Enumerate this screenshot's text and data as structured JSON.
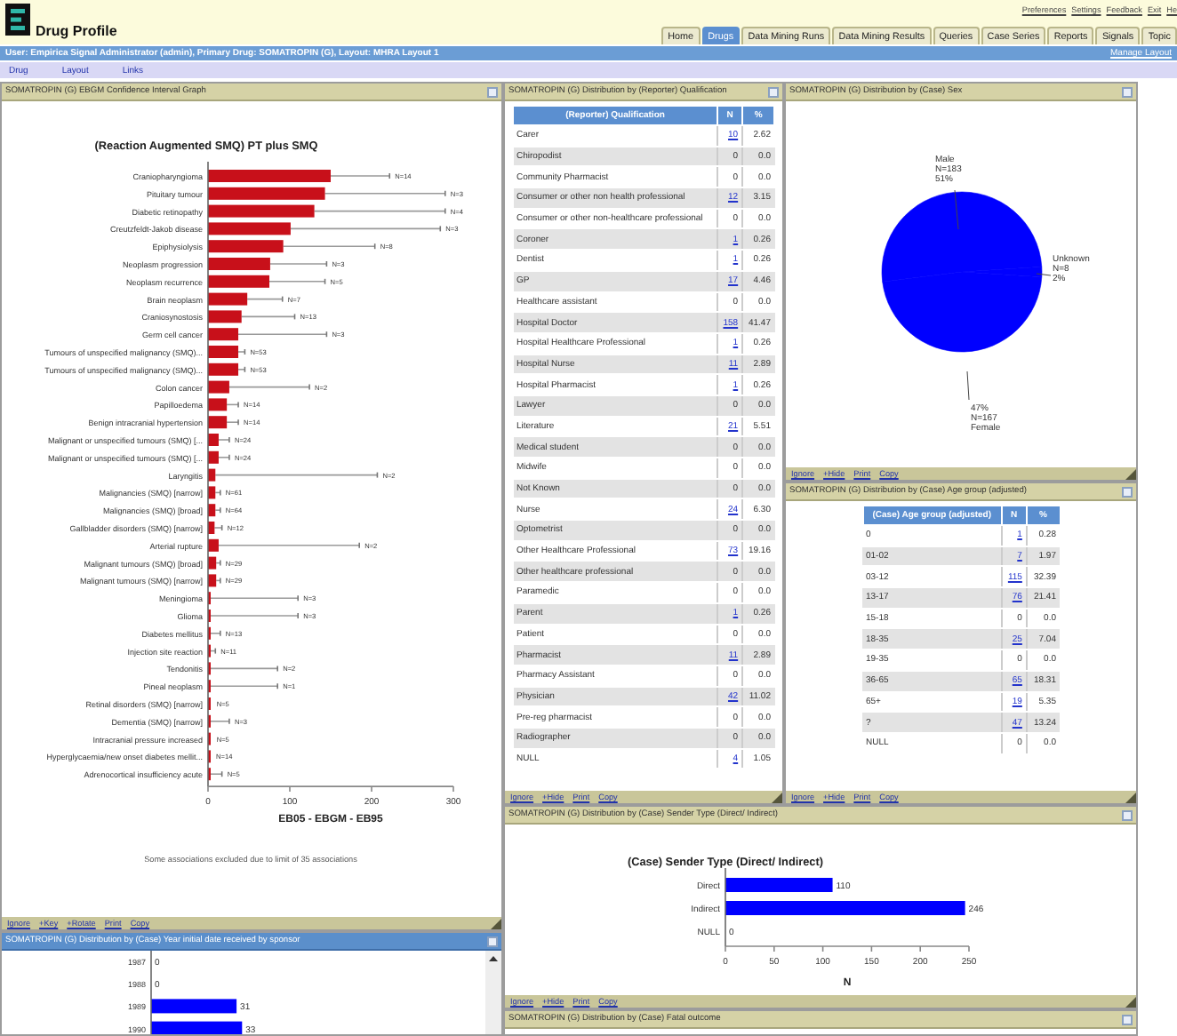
{
  "app": {
    "title": "Drug Profile",
    "links": [
      "Preferences",
      "Settings",
      "Feedback",
      "Exit",
      "He"
    ]
  },
  "tabs": [
    {
      "label": "Home",
      "selected": false
    },
    {
      "label": "Drugs",
      "selected": true
    },
    {
      "label": "Data Mining Runs",
      "selected": false
    },
    {
      "label": "Data Mining Results",
      "selected": false
    },
    {
      "label": "Queries",
      "selected": false
    },
    {
      "label": "Case Series",
      "selected": false
    },
    {
      "label": "Reports",
      "selected": false
    },
    {
      "label": "Signals",
      "selected": false
    },
    {
      "label": "Topic",
      "selected": false
    }
  ],
  "context_bar": {
    "text": "User: Empirica Signal Administrator (admin), Primary Drug: SOMATROPIN (G), Layout: MHRA Layout 1",
    "link": "Manage Layout"
  },
  "menu": [
    "Drug",
    "Layout",
    "Links"
  ],
  "ci_panel": {
    "title": "SOMATROPIN (G) EBGM Confidence Interval Graph",
    "selected": false,
    "chart_data": {
      "type": "bar",
      "orientation": "horizontal",
      "title": "(Reaction Augmented SMQ) PT plus SMQ",
      "xlabel": "EB05 - EBGM - EB95",
      "categories": [
        "Craniopharyngioma",
        "Pituitary tumour",
        "Diabetic retinopathy",
        "Creutzfeldt-Jakob disease",
        "Epiphysiolysis",
        "Neoplasm progression",
        "Neoplasm recurrence",
        "Brain neoplasm",
        "Craniosynostosis",
        "Germ cell cancer",
        "Tumours of unspecified malignancy (SMQ)...",
        "Tumours of unspecified malignancy (SMQ)...",
        "Colon cancer",
        "Papilloedema",
        "Benign intracranial hypertension",
        "Malignant or unspecified tumours (SMQ) [...",
        "Malignant or unspecified tumours (SMQ) [...",
        "Laryngitis",
        "Malignancies (SMQ) [narrow]",
        "Malignancies (SMQ) [broad]",
        "Gallbladder disorders (SMQ) [narrow]",
        "Arterial rupture",
        "Malignant tumours (SMQ) [broad]",
        "Malignant tumours (SMQ) [narrow]",
        "Meningioma",
        "Glioma",
        "Diabetes mellitus",
        "Injection site reaction",
        "Tendonitis",
        "Pineal neoplasm",
        "Retinal disorders (SMQ) [narrow]",
        "Dementia (SMQ) [narrow]",
        "Intracranial pressure increased",
        "Hyperglycaemia/new onset diabetes mellit...",
        "Adrenocortical insufficiency acute"
      ],
      "series": [
        {
          "color": "#c8101a",
          "values": [
            150,
            143,
            130,
            101,
            92,
            76,
            75,
            48,
            41,
            37,
            37,
            37,
            26,
            23,
            23,
            13,
            13,
            9,
            9,
            9,
            8,
            13,
            10,
            10,
            2,
            2,
            1,
            1,
            1,
            1,
            1,
            1,
            1,
            1,
            1
          ]
        }
      ],
      "xlim": [
        0,
        300
      ],
      "xticks": [
        0,
        100,
        200,
        300
      ],
      "annotations": [
        "N=14",
        "N=3",
        "N=4",
        "N=3",
        "N=8",
        "N=3",
        "N=5",
        "N=7",
        "N=13",
        "N=3",
        "N=53",
        "N=53",
        "N=2",
        "N=14",
        "N=14",
        "N=24",
        "N=24",
        "N=2",
        "N=61",
        "N=64",
        "N=12",
        "N=2",
        "N=29",
        "N=29",
        "N=3",
        "N=3",
        "N=13",
        "N=11",
        "N=2",
        "N=1",
        "N=5",
        "N=3",
        "N=5",
        "N=14",
        "N=5"
      ]
    },
    "note": "Some associations excluded due to limit of 35 associations",
    "footer": [
      "Ignore",
      "+Key",
      "+Rotate",
      "Print",
      "Copy"
    ]
  },
  "year_panel": {
    "title": "SOMATROPIN (G) Distribution by (Case) Year initial date received by sponsor",
    "selected": true,
    "chart_data": {
      "type": "bar",
      "orientation": "horizontal",
      "categories": [
        "1987",
        "1988",
        "1989",
        "1990"
      ],
      "series": [
        {
          "color": "#0000ff",
          "values": [
            0,
            0,
            31,
            33
          ]
        }
      ],
      "data_labels": true
    }
  },
  "qualification_panel": {
    "title": "SOMATROPIN (G) Distribution by (Reporter) Qualification",
    "selected": false,
    "columns": [
      "(Reporter) Qualification",
      "N",
      "%"
    ],
    "rows": [
      {
        "label": "Carer",
        "n": "10",
        "pct": "2.62",
        "linked": true
      },
      {
        "label": "Chiropodist",
        "n": "0",
        "pct": "0.0",
        "linked": false
      },
      {
        "label": "Community Pharmacist",
        "n": "0",
        "pct": "0.0",
        "linked": false
      },
      {
        "label": "Consumer or other non health professional",
        "n": "12",
        "pct": "3.15",
        "linked": true
      },
      {
        "label": "Consumer or other non-healthcare professional",
        "n": "0",
        "pct": "0.0",
        "linked": false
      },
      {
        "label": "Coroner",
        "n": "1",
        "pct": "0.26",
        "linked": true
      },
      {
        "label": "Dentist",
        "n": "1",
        "pct": "0.26",
        "linked": true
      },
      {
        "label": "GP",
        "n": "17",
        "pct": "4.46",
        "linked": true
      },
      {
        "label": "Healthcare assistant",
        "n": "0",
        "pct": "0.0",
        "linked": false
      },
      {
        "label": "Hospital Doctor",
        "n": "158",
        "pct": "41.47",
        "linked": true
      },
      {
        "label": "Hospital Healthcare Professional",
        "n": "1",
        "pct": "0.26",
        "linked": true
      },
      {
        "label": "Hospital Nurse",
        "n": "11",
        "pct": "2.89",
        "linked": true
      },
      {
        "label": "Hospital Pharmacist",
        "n": "1",
        "pct": "0.26",
        "linked": true
      },
      {
        "label": "Lawyer",
        "n": "0",
        "pct": "0.0",
        "linked": false
      },
      {
        "label": "Literature",
        "n": "21",
        "pct": "5.51",
        "linked": true
      },
      {
        "label": "Medical student",
        "n": "0",
        "pct": "0.0",
        "linked": false
      },
      {
        "label": "Midwife",
        "n": "0",
        "pct": "0.0",
        "linked": false
      },
      {
        "label": "Not Known",
        "n": "0",
        "pct": "0.0",
        "linked": false
      },
      {
        "label": "Nurse",
        "n": "24",
        "pct": "6.30",
        "linked": true
      },
      {
        "label": "Optometrist",
        "n": "0",
        "pct": "0.0",
        "linked": false
      },
      {
        "label": "Other Healthcare Professional",
        "n": "73",
        "pct": "19.16",
        "linked": true
      },
      {
        "label": "Other healthcare professional",
        "n": "0",
        "pct": "0.0",
        "linked": false
      },
      {
        "label": "Paramedic",
        "n": "0",
        "pct": "0.0",
        "linked": false
      },
      {
        "label": "Parent",
        "n": "1",
        "pct": "0.26",
        "linked": true
      },
      {
        "label": "Patient",
        "n": "0",
        "pct": "0.0",
        "linked": false
      },
      {
        "label": "Pharmacist",
        "n": "11",
        "pct": "2.89",
        "linked": true
      },
      {
        "label": "Pharmacy Assistant",
        "n": "0",
        "pct": "0.0",
        "linked": false
      },
      {
        "label": "Physician",
        "n": "42",
        "pct": "11.02",
        "linked": true
      },
      {
        "label": "Pre-reg pharmacist",
        "n": "0",
        "pct": "0.0",
        "linked": false
      },
      {
        "label": "Radiographer",
        "n": "0",
        "pct": "0.0",
        "linked": false
      },
      {
        "label": "NULL",
        "n": "4",
        "pct": "1.05",
        "linked": true
      }
    ],
    "footer": [
      "Ignore",
      "+Hide",
      "Print",
      "Copy"
    ]
  },
  "sex_panel": {
    "title": "SOMATROPIN (G) Distribution by (Case) Sex",
    "selected": false,
    "chart_data": {
      "type": "pie",
      "series": [
        {
          "color": "#0000ff",
          "values": [
            51,
            2,
            47
          ]
        }
      ],
      "annotations": [
        {
          "text": "Male\nN=183\n51%"
        },
        {
          "text": "Unknown\nN=8\n2%"
        },
        {
          "text": "47%\nN=167\nFemale"
        }
      ]
    },
    "footer": [
      "Ignore",
      "+Hide",
      "Print",
      "Copy"
    ]
  },
  "age_panel": {
    "title": "SOMATROPIN (G) Distribution by (Case) Age group (adjusted)",
    "selected": false,
    "columns": [
      "(Case) Age group (adjusted)",
      "N",
      "%"
    ],
    "rows": [
      {
        "label": "0",
        "n": "1",
        "pct": "0.28",
        "linked": true
      },
      {
        "label": "01-02",
        "n": "7",
        "pct": "1.97",
        "linked": true
      },
      {
        "label": "03-12",
        "n": "115",
        "pct": "32.39",
        "linked": true
      },
      {
        "label": "13-17",
        "n": "76",
        "pct": "21.41",
        "linked": true
      },
      {
        "label": "15-18",
        "n": "0",
        "pct": "0.0",
        "linked": false
      },
      {
        "label": "18-35",
        "n": "25",
        "pct": "7.04",
        "linked": true
      },
      {
        "label": "19-35",
        "n": "0",
        "pct": "0.0",
        "linked": false
      },
      {
        "label": "36-65",
        "n": "65",
        "pct": "18.31",
        "linked": true
      },
      {
        "label": "65+",
        "n": "19",
        "pct": "5.35",
        "linked": true
      },
      {
        "label": "?",
        "n": "47",
        "pct": "13.24",
        "linked": true
      },
      {
        "label": "NULL",
        "n": "0",
        "pct": "0.0",
        "linked": false
      }
    ],
    "footer": [
      "Ignore",
      "+Hide",
      "Print",
      "Copy"
    ]
  },
  "sender_panel": {
    "title": "SOMATROPIN (G) Distribution by (Case) Sender Type (Direct/ Indirect)",
    "selected": false,
    "chart_data": {
      "type": "bar",
      "orientation": "horizontal",
      "title": "(Case) Sender Type (Direct/ Indirect)",
      "xlabel": "N",
      "categories": [
        "Direct",
        "Indirect",
        "NULL"
      ],
      "series": [
        {
          "color": "#0000ff",
          "values": [
            110,
            246,
            0
          ]
        }
      ],
      "xlim": [
        0,
        250
      ],
      "xticks": [
        0,
        50,
        100,
        150,
        200,
        250
      ],
      "data_labels": true
    },
    "footer": [
      "Ignore",
      "+Hide",
      "Print",
      "Copy"
    ]
  },
  "fatal_panel": {
    "title": "SOMATROPIN (G) Distribution by (Case) Fatal outcome",
    "selected": false
  }
}
